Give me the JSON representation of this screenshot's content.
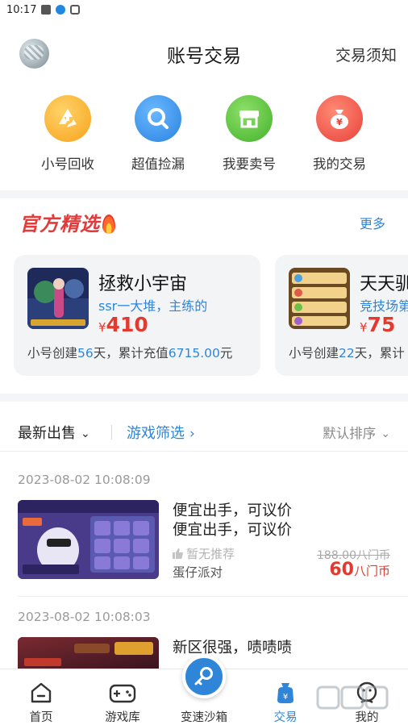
{
  "status": {
    "time": "10:17"
  },
  "header": {
    "title": "账号交易",
    "notice": "交易须知"
  },
  "quick_actions": [
    {
      "label": "小号回收",
      "icon": "recycle-icon",
      "color": "#fbb12b"
    },
    {
      "label": "超值捡漏",
      "icon": "magnifier-icon",
      "color": "#2f8ce6"
    },
    {
      "label": "我要卖号",
      "icon": "shop-icon",
      "color": "#56c23a"
    },
    {
      "label": "我的交易",
      "icon": "money-bag-icon",
      "color": "#ef5146"
    }
  ],
  "featured": {
    "title": "官方精选",
    "more": "更多",
    "cards": [
      {
        "name": "拯救小宇宙",
        "tag": "ssr一大堆，主练的",
        "currency": "¥",
        "price": "410",
        "stat_prefix": "小号创建",
        "days": "56",
        "stat_mid": "天，累计充值",
        "amount": "6715.00",
        "stat_suffix": "元"
      },
      {
        "name": "天天驯",
        "tag": "竞技场第",
        "currency": "¥",
        "price": "75",
        "stat_prefix": "小号创建",
        "days": "22",
        "stat_mid": "天，累计"
      }
    ]
  },
  "filters": {
    "latest": "最新出售",
    "game_filter": "游戏筛选",
    "sort": "默认排序"
  },
  "listings": [
    {
      "time": "2023-08-02 10:08:09",
      "title_line1": "便宜出手，可议价",
      "title_line2": "便宜出手，可议价",
      "recommend": "暂无推荐",
      "game": "蛋仔派对",
      "old_price": "188.00八门币",
      "price": "60",
      "unit": "八门币"
    },
    {
      "time": "2023-08-02 10:08:03",
      "title_line1": "新区很强，啧啧啧"
    }
  ],
  "tabs": [
    {
      "label": "首页",
      "icon": "home-icon"
    },
    {
      "label": "游戏库",
      "icon": "gamepad-icon"
    },
    {
      "label": "变速沙箱",
      "icon": "key-icon"
    },
    {
      "label": "交易",
      "icon": "trade-bag-icon",
      "active": true
    },
    {
      "label": "我的",
      "icon": "user-icon"
    }
  ]
}
